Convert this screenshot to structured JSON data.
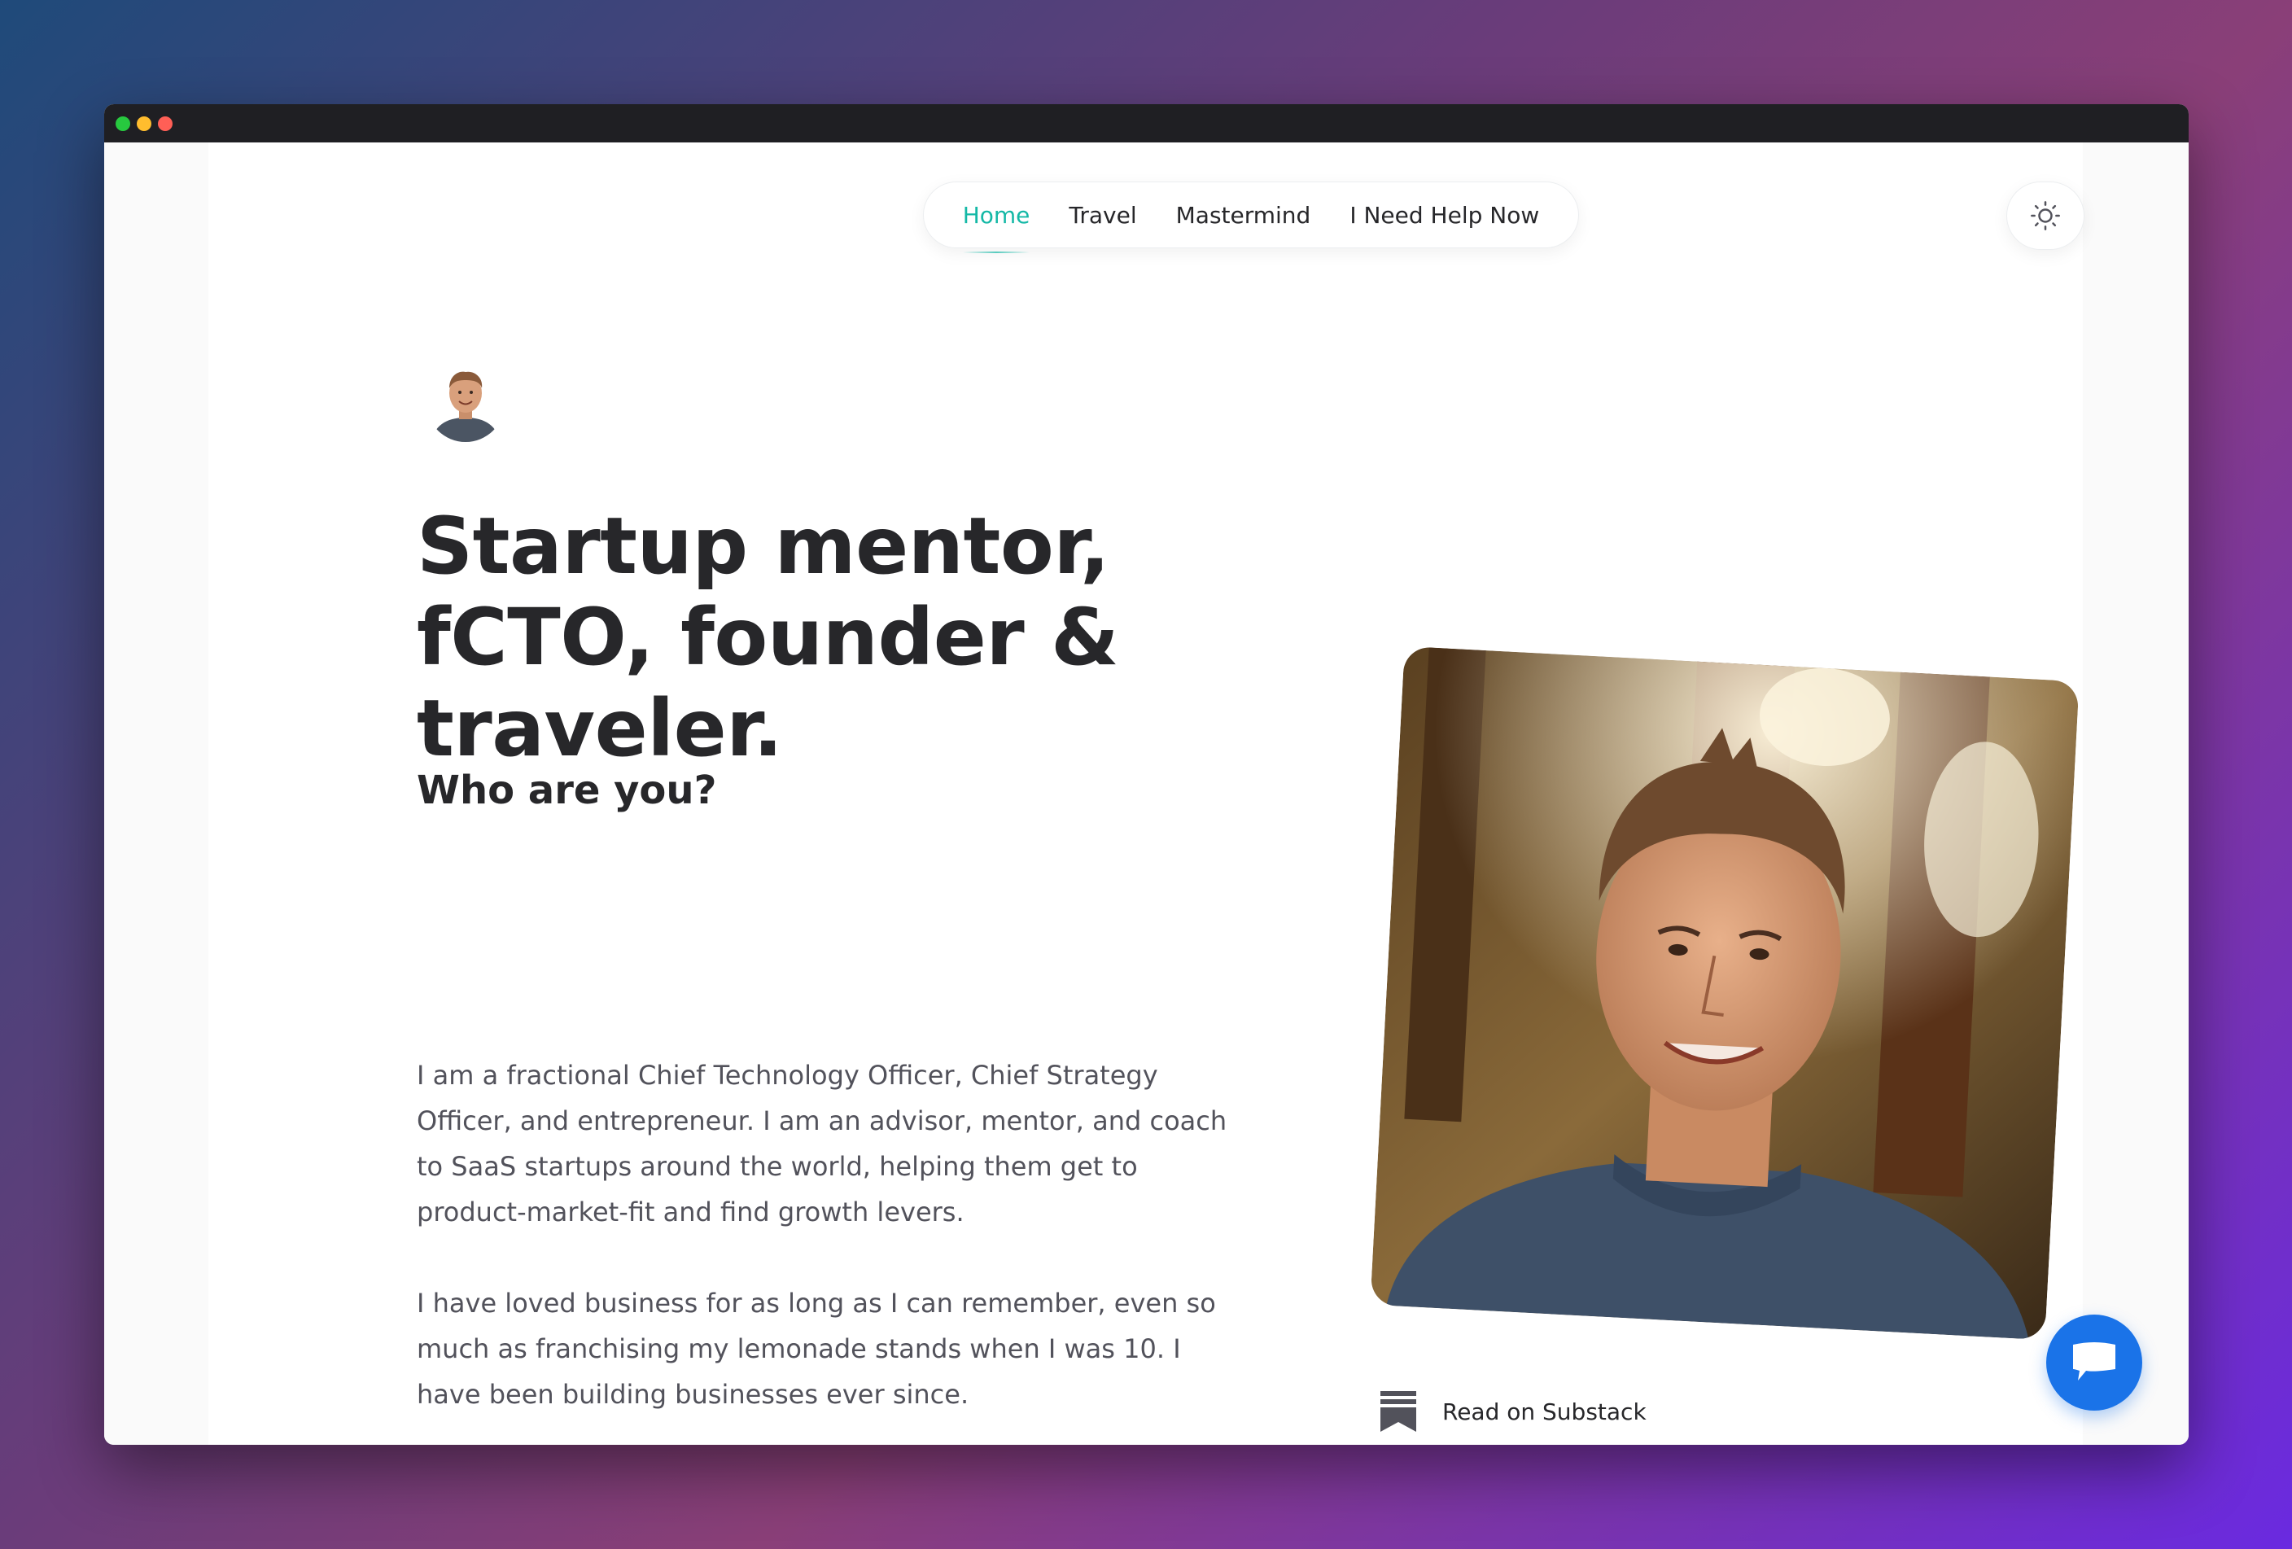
{
  "window": {
    "controls": [
      "close",
      "minimize",
      "maximize"
    ]
  },
  "nav": {
    "items": [
      {
        "label": "Home",
        "active": true
      },
      {
        "label": "Travel"
      },
      {
        "label": "Mastermind"
      },
      {
        "label": "I Need Help Now"
      }
    ]
  },
  "theme_toggle": {
    "icon": "sun-icon"
  },
  "hero": {
    "headline": "Startup mentor, fCTO, founder & traveler.",
    "subheading": "Who are you?",
    "paragraphs": [
      "I am a fractional Chief Technology Officer, Chief Strategy Officer, and entrepreneur. I am an advisor, mentor, and coach to SaaS startups around the world, helping them get to product-market-fit and find growth levers.",
      "I have loved business for as long as I can remember, even so much as franchising my lemonade stands when I was 10. I have been building businesses ever since."
    ]
  },
  "substack": {
    "label": "Read on Substack",
    "icon": "substack-icon"
  },
  "chat": {
    "icon": "chat-icon"
  },
  "colors": {
    "accent": "#14b8a6",
    "chat": "#1a73e8",
    "text": "#27272a",
    "muted": "#52525b"
  }
}
